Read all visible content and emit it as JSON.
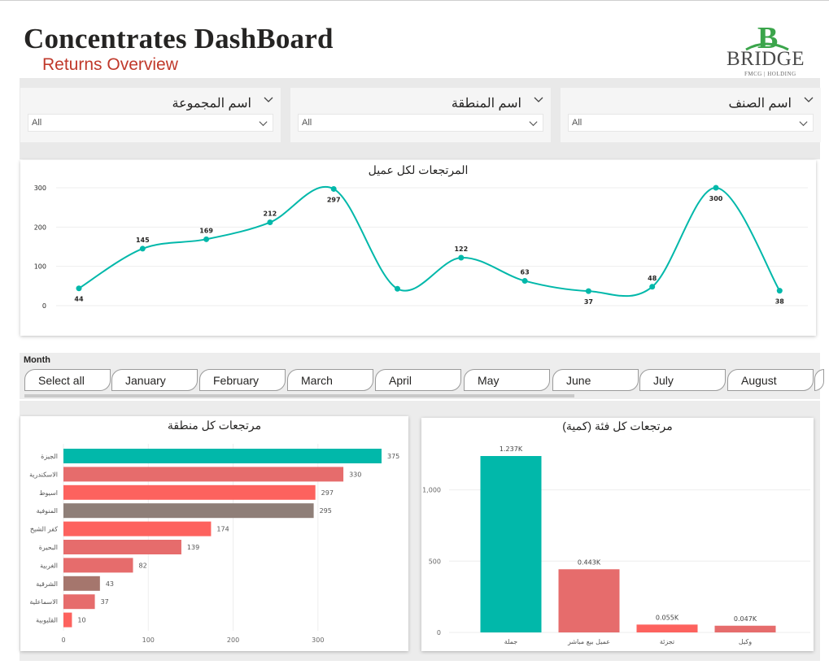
{
  "header": {
    "title": "Concentrates DashBoard",
    "subtitle": "Returns Overview",
    "logo": {
      "mark": "B",
      "word": "BRIDGE",
      "tagline": "FMCG | HOLDING"
    }
  },
  "slicers": [
    {
      "label": "اسم الصنف",
      "value": "All"
    },
    {
      "label": "اسم المنطقة",
      "value": "All"
    },
    {
      "label": "اسم المجموعة",
      "value": "All"
    }
  ],
  "month_slicer": {
    "label": "Month",
    "options": [
      "Select all",
      "January",
      "February",
      "March",
      "April",
      "May",
      "June",
      "July",
      "August"
    ]
  },
  "colors": {
    "teal": "#01B8AA",
    "coral": "#FD625E",
    "dusty_red": "#E66C6C",
    "mauve": "#A5766D",
    "taupe": "#8F7F78",
    "title_red": "#C0392B",
    "logo_green": "#3BA54B"
  },
  "chart_data": [
    {
      "id": "line",
      "type": "line",
      "title": "المرتجعات لكل عميل",
      "values": [
        44,
        145,
        169,
        212,
        297,
        43,
        122,
        63,
        37,
        48,
        300,
        38
      ],
      "labels": [
        "44",
        "145",
        "169",
        "212",
        "297",
        "",
        "122",
        "63",
        "37",
        "48",
        "300",
        "38"
      ],
      "yticks": [
        0,
        100,
        200,
        300
      ],
      "ylim": [
        0,
        300
      ],
      "grid": true,
      "color": "#01B8AA"
    },
    {
      "id": "region",
      "type": "bar",
      "orientation": "horizontal",
      "title": "مرتجعات كل منطقة",
      "categories": [
        "الجيزة",
        "الاسكندرية",
        "اسيوط",
        "المنوفية",
        "كفر الشيخ",
        "البحيرة",
        "الغربية",
        "الشرقية",
        "الاسماعلية",
        "القليوبية"
      ],
      "values": [
        375,
        330,
        297,
        295,
        174,
        139,
        82,
        43,
        37,
        10
      ],
      "colors": [
        "#01B8AA",
        "#E66C6C",
        "#FD625E",
        "#8F7F78",
        "#FD625E",
        "#E66C6C",
        "#E66C6C",
        "#A5766D",
        "#E66C6C",
        "#FD625E"
      ],
      "xticks": [
        0,
        100,
        200,
        300
      ],
      "xlim": [
        0,
        375
      ],
      "grid": true
    },
    {
      "id": "category",
      "type": "bar",
      "title": "مرتجعات كل فئة (كمية)",
      "categories": [
        "جملة",
        "عميل بيع مباشر",
        "تجزئة",
        "وكيل"
      ],
      "values": [
        1237,
        443,
        55,
        47
      ],
      "value_labels": [
        "1.237K",
        "0.443K",
        "0.055K",
        "0.047K"
      ],
      "colors": [
        "#01B8AA",
        "#E66C6C",
        "#FD625E",
        "#E66C6C"
      ],
      "yticks": [
        0,
        500,
        1000
      ],
      "ytick_labels": [
        "0",
        "500",
        "1,000"
      ],
      "ylim": [
        0,
        1237
      ],
      "grid": true
    }
  ]
}
